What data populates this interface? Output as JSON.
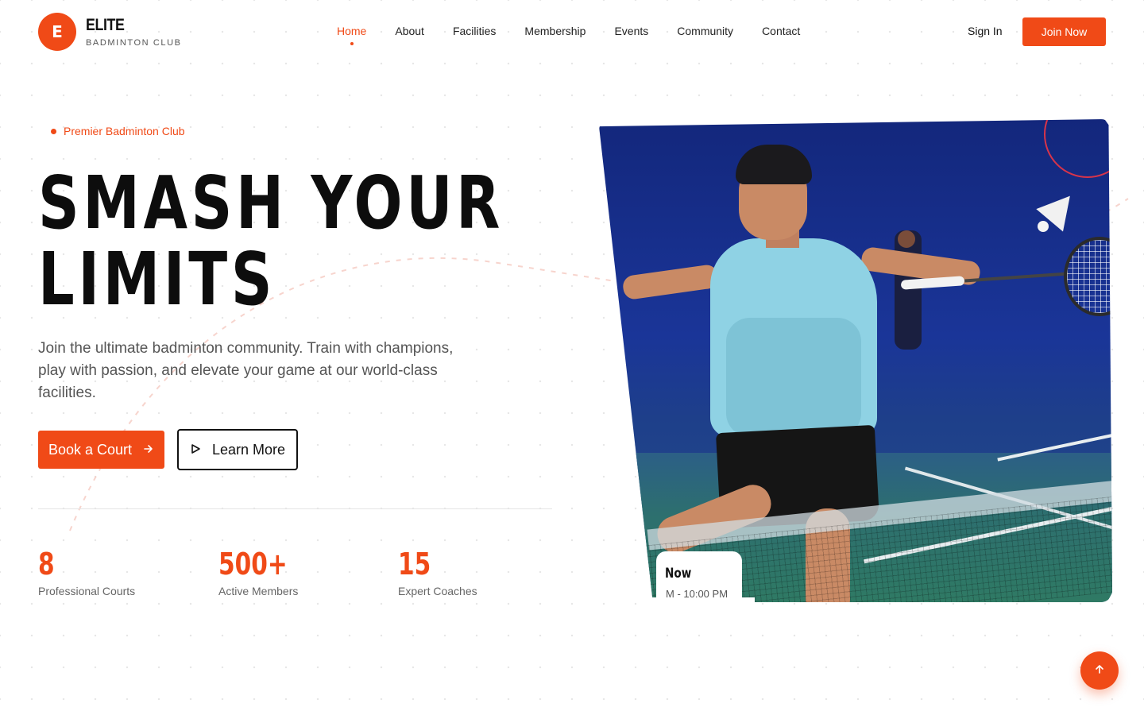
{
  "brand": {
    "logo_letter": "E",
    "name": "ELITE",
    "subtitle": "BADMINTON CLUB",
    "accent": "#f04a17"
  },
  "nav": {
    "items": [
      {
        "label": "Home",
        "active": true
      },
      {
        "label": "About"
      },
      {
        "label": "Facilities"
      },
      {
        "label": "Membership"
      },
      {
        "label": "Events"
      },
      {
        "label": "Community"
      },
      {
        "label": "Contact"
      }
    ],
    "sign_in": "Sign In",
    "join": "Join Now"
  },
  "hero": {
    "kicker": "Premier Badminton Club",
    "title": "SMASH YOUR LIMITS",
    "description": "Join the ultimate badminton community. Train with champions, play with passion, and elevate your game at our world-class facilities.",
    "primary_button": "Book a Court",
    "secondary_button": "Learn More"
  },
  "stats": [
    {
      "value": "8",
      "label": "Professional Courts"
    },
    {
      "value": "500+",
      "label": "Active Members"
    },
    {
      "value": "15",
      "label": "Expert Coaches"
    }
  ],
  "schedule_card": {
    "title": "Now",
    "time": "M - 10:00 PM"
  },
  "icons": {
    "arrow_right": "arrow-right-icon",
    "play": "play-icon",
    "arrow_up": "arrow-up-icon"
  }
}
